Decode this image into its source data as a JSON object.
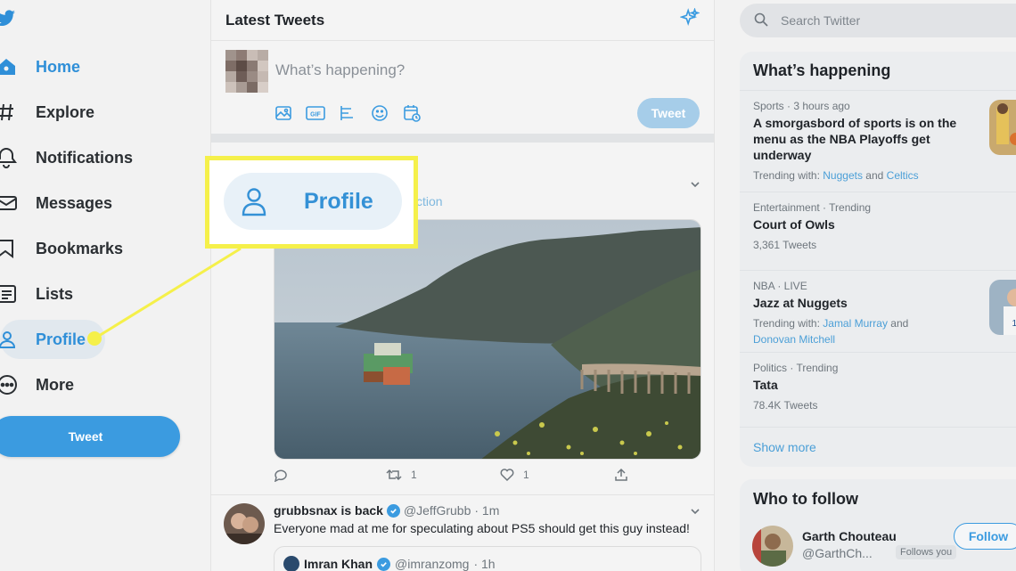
{
  "nav": {
    "items": [
      {
        "label": "Home",
        "icon": "home-icon"
      },
      {
        "label": "Explore",
        "icon": "hashtag-icon"
      },
      {
        "label": "Notifications",
        "icon": "bell-icon"
      },
      {
        "label": "Messages",
        "icon": "envelope-icon"
      },
      {
        "label": "Bookmarks",
        "icon": "bookmark-icon"
      },
      {
        "label": "Lists",
        "icon": "list-icon"
      },
      {
        "label": "Profile",
        "icon": "person-icon"
      },
      {
        "label": "More",
        "icon": "more-circle-icon"
      }
    ],
    "tweet_button": "Tweet"
  },
  "timeline": {
    "title": "Latest Tweets",
    "compose_placeholder": "What’s happening?",
    "compose_button": "Tweet",
    "tools": [
      "image-icon",
      "gif-icon",
      "poll-icon",
      "emoji-icon",
      "schedule-icon"
    ],
    "tweet1": {
      "link_fragment": "ction",
      "retweets": "1",
      "likes": "1"
    },
    "tweet2": {
      "name": "grubbsnax is back",
      "handle": "@JeffGrubb",
      "time": "· 1m",
      "text": "Everyone mad at me for speculating about PS5 should get this guy instead!",
      "quote_name": "Imran Khan",
      "quote_handle": "@imranzomg",
      "quote_time": "· 1h"
    }
  },
  "search": {
    "placeholder": "Search Twitter"
  },
  "whats_happening": {
    "title": "What’s happening",
    "trends": [
      {
        "meta": "Sports · 3 hours ago",
        "title": "A smorgasbord of sports is on the menu as the NBA Playoffs get underway",
        "sub_prefix": "Trending with: ",
        "link1": "Nuggets",
        "mid": " and ",
        "link2": "Celtics"
      },
      {
        "meta": "Entertainment · Trending",
        "title": "Court of Owls",
        "count": "3,361 Tweets"
      },
      {
        "meta": "NBA · LIVE",
        "title": "Jazz at Nuggets",
        "sub_prefix": "Trending with: ",
        "link1": "Jamal Murray",
        "mid": " and",
        "link2": "Donovan Mitchell"
      },
      {
        "meta": "Politics · Trending",
        "title": "Tata",
        "count": "78.4K Tweets"
      }
    ],
    "show_more": "Show more"
  },
  "who_to_follow": {
    "title": "Who to follow",
    "user": {
      "name": "Garth Chouteau",
      "handle": "@GarthCh...",
      "badge": "Follows you",
      "button": "Follow"
    }
  },
  "callout": {
    "label": "Profile"
  },
  "colors": {
    "accent": "#2f8fd8",
    "highlight": "#f5f04a",
    "button": "#3b9be0"
  }
}
